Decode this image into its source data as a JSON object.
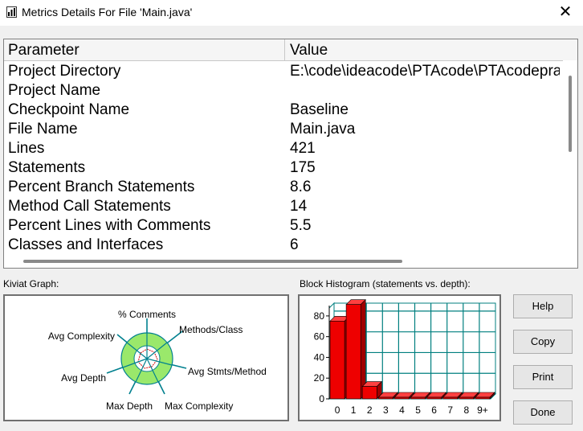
{
  "window": {
    "title": "Metrics Details For File 'Main.java'",
    "close_glyph": "✕"
  },
  "table": {
    "headers": {
      "parameter": "Parameter",
      "value": "Value"
    },
    "rows": [
      {
        "parameter": "Project Directory",
        "value": "E:\\code\\ideacode\\PTAcode\\PTAcodepractice"
      },
      {
        "parameter": "Project Name",
        "value": ""
      },
      {
        "parameter": "Checkpoint Name",
        "value": "Baseline"
      },
      {
        "parameter": "File Name",
        "value": "Main.java"
      },
      {
        "parameter": "Lines",
        "value": "421"
      },
      {
        "parameter": "Statements",
        "value": "175"
      },
      {
        "parameter": "Percent Branch Statements",
        "value": "8.6"
      },
      {
        "parameter": "Method Call Statements",
        "value": "14"
      },
      {
        "parameter": "Percent Lines with Comments",
        "value": "5.5"
      },
      {
        "parameter": "Classes and Interfaces",
        "value": "6"
      }
    ]
  },
  "kiviat": {
    "label": "Kiviat Graph:",
    "axes": {
      "comments": "% Comments",
      "methods_class": "Methods/Class",
      "avg_stmts": "Avg Stmts/Method",
      "max_complexity": "Max Complexity",
      "max_depth": "Max Depth",
      "avg_depth": "Avg Depth",
      "avg_complexity": "Avg Complexity"
    }
  },
  "histogram": {
    "label": "Block Histogram (statements vs. depth):",
    "y_ticks": [
      "80",
      "60",
      "40",
      "20",
      "0"
    ],
    "x_ticks": [
      "0",
      "1",
      "2",
      "3",
      "4",
      "5",
      "6",
      "7",
      "8",
      "9+"
    ]
  },
  "chart_data": {
    "type": "bar",
    "categories": [
      "0",
      "1",
      "2",
      "3",
      "4",
      "5",
      "6",
      "7",
      "8",
      "9+"
    ],
    "values": [
      75,
      91,
      12,
      1,
      1,
      1,
      1,
      1,
      1,
      1
    ],
    "ylim": [
      0,
      90
    ],
    "grid": true
  },
  "buttons": {
    "help": "Help",
    "copy": "Copy",
    "print": "Print",
    "done": "Done"
  },
  "colors": {
    "bar": "#ee0000",
    "grid": "#007f7f",
    "kiviat_fill": "#9ae86b"
  }
}
